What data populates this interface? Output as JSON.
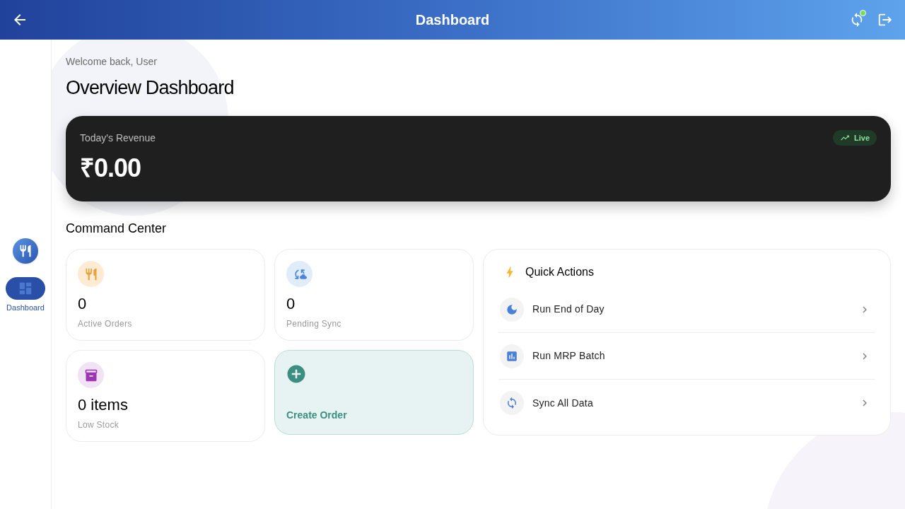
{
  "header": {
    "title": "Dashboard"
  },
  "nav_rail": {
    "items": [
      {
        "label": "Dashboard",
        "selected": true
      }
    ]
  },
  "welcome": "Welcome back, User",
  "page_title": "Overview Dashboard",
  "revenue": {
    "label": "Today's Revenue",
    "amount": "₹0.00",
    "badge": "Live"
  },
  "command_center": {
    "title": "Command Center",
    "cards": [
      {
        "kind": "stat",
        "value": "0",
        "label": "Active Orders"
      },
      {
        "kind": "stat",
        "value": "0",
        "label": "Pending Sync"
      },
      {
        "kind": "stat",
        "value": "0 items",
        "label": "Low Stock"
      },
      {
        "kind": "action",
        "label": "Create Order"
      }
    ]
  },
  "quick_actions": {
    "title": "Quick Actions",
    "items": [
      {
        "label": "Run End of Day"
      },
      {
        "label": "Run MRP Batch"
      },
      {
        "label": "Sync All Data"
      }
    ]
  }
}
